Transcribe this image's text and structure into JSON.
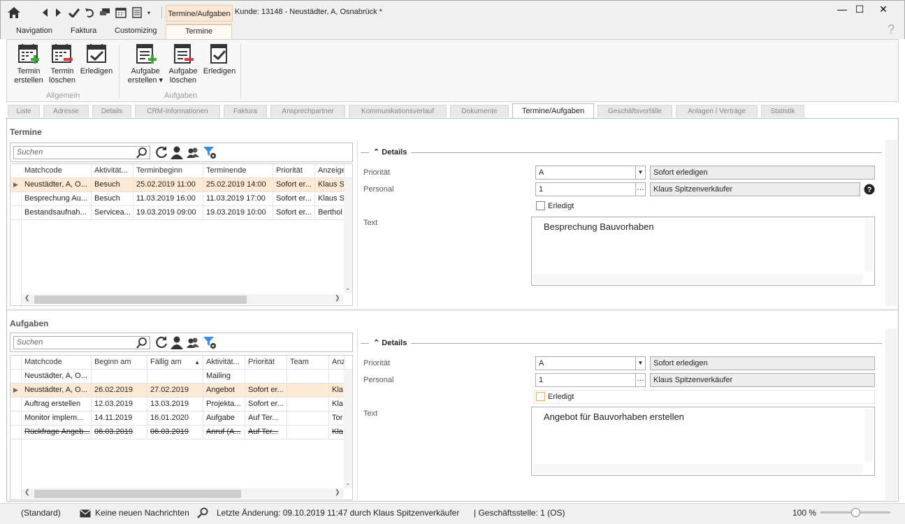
{
  "titlebar": {
    "active_tab": "Termine/Aufgaben",
    "window_title": "Kunde: 13148 - Neustädter, A, Osnabrück *",
    "minimize": "—",
    "maximize": "☐",
    "close": "✕"
  },
  "menu": {
    "tabs": [
      "Navigation",
      "Faktura",
      "Customizing",
      "Termine"
    ],
    "help": "?"
  },
  "ribbon": {
    "termin_erstellen": [
      "Termin",
      "erstellen"
    ],
    "termin_loeschen": [
      "Termin",
      "löschen"
    ],
    "erledigen1": "Erledigen",
    "group_allgemein": "Allgemein",
    "aufgabe_erstellen": [
      "Aufgabe",
      "erstellen ▾"
    ],
    "aufgabe_loeschen": [
      "Aufgabe",
      "löschen"
    ],
    "erledigen2": "Erledigen",
    "group_aufgaben": "Aufgaben"
  },
  "page_tabs": [
    "Liste",
    "Adresse",
    "Details",
    "CRM-Informationen",
    "Faktura",
    "Ansprechpartner",
    "Kommunikationsverlauf",
    "Dokumente",
    "Termine/Aufgaben",
    "Geschäftsvorfälle",
    "Anlagen / Verträge",
    "Statistik"
  ],
  "termine": {
    "title": "Termine",
    "search_placeholder": "Suchen",
    "columns": [
      "Matchcode",
      "Aktivität...",
      "Terminbeginn",
      "Terminende",
      "Priorität",
      "Anzeige"
    ],
    "rows": [
      [
        "Neustädter, A, O...",
        "Besuch",
        "25.02.2019 11:00",
        "25.02.2019 14:00",
        "Sofort er...",
        "Klaus S"
      ],
      [
        "Besprechung Au...",
        "Besuch",
        "11.03.2019 16:00",
        "11.03.2019 17:00",
        "Sofort er...",
        "Klaus S"
      ],
      [
        "Bestandsaufnah...",
        "Servicea...",
        "19.03.2019 09:00",
        "19.03.2019 10:00",
        "Sofort er...",
        "Berthol"
      ]
    ],
    "details": {
      "header": "Details",
      "prioritaet_label": "Priorität",
      "prioritaet_value": "A",
      "prioritaet_text": "Sofort erledigen",
      "personal_label": "Personal",
      "personal_value": "1",
      "personal_name": "Klaus Spitzenverkäufer",
      "erledigt_label": "Erledigt",
      "text_label": "Text",
      "text_value": "Besprechung Bauvorhaben"
    }
  },
  "aufgaben": {
    "title": "Aufgaben",
    "search_placeholder": "Suchen",
    "columns": [
      "Matchcode",
      "Beginn am",
      "Fällig am",
      "Aktivität...",
      "Priorität",
      "Team",
      "Anz"
    ],
    "rows": [
      [
        "Neustädter, A, O...",
        "",
        "",
        "Mailing",
        "",
        "",
        ""
      ],
      [
        "Neustädter, A, O...",
        "26.02.2019",
        "27.02.2019",
        "Angebot",
        "Sofort er...",
        "",
        "Kla"
      ],
      [
        "Auftrag erstellen",
        "12.03.2019",
        "13.03.2019",
        "Projekta...",
        "Sofort er...",
        "",
        "Kla"
      ],
      [
        "Monitor implem...",
        "14.11.2019",
        "16.01.2020",
        "Aufgabe",
        "Auf Ter...",
        "",
        "Tor"
      ],
      [
        "Rückfrage Angeb...",
        "06.03.2019",
        "06.03.2019",
        "Anruf (A...",
        "Auf Ter...",
        "",
        "Kla"
      ]
    ],
    "details": {
      "header": "Details",
      "prioritaet_label": "Priorität",
      "prioritaet_value": "A",
      "prioritaet_text": "Sofort erledigen",
      "personal_label": "Personal",
      "personal_value": "1",
      "personal_name": "Klaus Spitzenverkäufer",
      "erledigt_label": "Erledigt",
      "text_label": "Text",
      "text_value": "Angebot für Bauvorhaben erstellen"
    }
  },
  "statusbar": {
    "standard": "(Standard)",
    "messages": "Keine neuen Nachrichten",
    "last_change": "Letzte Änderung: 09.10.2019 11:47 durch Klaus Spitzenverkäufer",
    "branch": "| Geschäftsstelle: 1 (OS)",
    "zoom": "100 %",
    "zoom_level": 0.5
  }
}
